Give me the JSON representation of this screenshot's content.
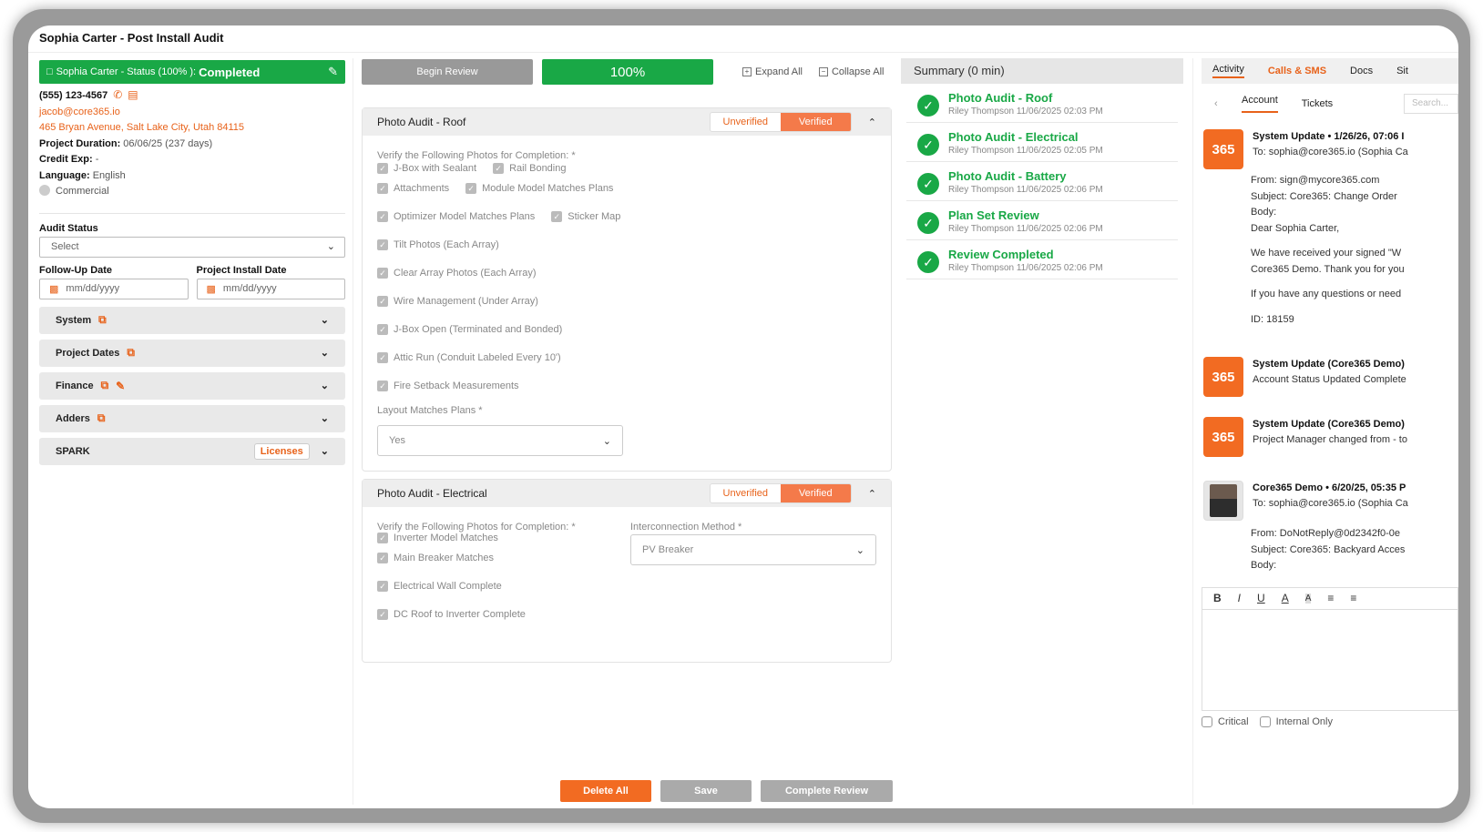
{
  "title": "Sophia Carter - Post Install Audit",
  "left": {
    "status_prefix": "Sophia Carter - Status (100% ):",
    "status_value": "Completed",
    "phone": "(555) 123-4567",
    "email": "jacob@core365.io",
    "address": "465 Bryan Avenue, Salt Lake City, Utah 84115",
    "duration_label": "Project Duration:",
    "duration_value": "06/06/25 (237 days)",
    "credit_label": "Credit Exp:",
    "credit_value": "-",
    "language_label": "Language:",
    "language_value": "English",
    "commercial": "Commercial",
    "audit_status_label": "Audit Status",
    "audit_status_value": "Select",
    "followup_label": "Follow-Up Date",
    "install_label": "Project Install Date",
    "date_placeholder": "mm/dd/yyyy",
    "sections": [
      "System",
      "Project Dates",
      "Finance",
      "Adders",
      "SPARK"
    ],
    "licenses": "Licenses"
  },
  "mid": {
    "begin_review": "Begin Review",
    "percent": "100%",
    "expand_all": "Expand All",
    "collapse_all": "Collapse All",
    "unverified": "Unverified",
    "verified": "Verified",
    "roof": {
      "title": "Photo Audit - Roof",
      "verify_label": "Verify the Following Photos for Completion: *",
      "rows": [
        [
          "J-Box with Sealant",
          "Rail Bonding"
        ],
        [
          "Attachments",
          "Module Model Matches Plans"
        ],
        [
          "Optimizer Model Matches Plans",
          "Sticker Map"
        ],
        [
          "Tilt Photos (Each Array)"
        ],
        [
          "Clear Array Photos (Each Array)"
        ],
        [
          "Wire Management (Under Array)"
        ],
        [
          "J-Box Open (Terminated and Bonded)"
        ],
        [
          "Attic Run (Conduit Labeled Every 10')"
        ],
        [
          "Fire Setback Measurements"
        ]
      ],
      "layout_label": "Layout Matches Plans *",
      "layout_value": "Yes"
    },
    "electrical": {
      "title": "Photo Audit - Electrical",
      "verify_label": "Verify the Following Photos for Completion: *",
      "items": [
        "Inverter Model Matches",
        "Main Breaker Matches",
        "Electrical Wall Complete",
        "DC Roof to Inverter Complete"
      ],
      "interconnect_label": "Interconnection Method *",
      "interconnect_value": "PV Breaker"
    },
    "delete_all": "Delete All",
    "save": "Save",
    "complete_review": "Complete Review"
  },
  "summary": {
    "title": "Summary (0 min)",
    "items": [
      {
        "title": "Photo Audit - Roof",
        "sub": "Riley Thompson 11/06/2025 02:03 PM"
      },
      {
        "title": "Photo Audit - Electrical",
        "sub": "Riley Thompson 11/06/2025 02:05 PM"
      },
      {
        "title": "Photo Audit - Battery",
        "sub": "Riley Thompson 11/06/2025 02:06 PM"
      },
      {
        "title": "Plan Set Review",
        "sub": "Riley Thompson 11/06/2025 02:06 PM"
      },
      {
        "title": "Review Completed",
        "sub": "Riley Thompson 11/06/2025 02:06 PM"
      }
    ]
  },
  "right": {
    "tabs": [
      "Activity",
      "Calls & SMS",
      "Docs",
      "Sit"
    ],
    "subtabs": [
      "Account",
      "Tickets"
    ],
    "search_placeholder": "Search...",
    "m1_title": "System Update • 1/26/26, 07:06 I",
    "m1_to": "To: sophia@core365.io (Sophia Ca",
    "m1_body": [
      "From: sign@mycore365.com",
      "Subject: Core365: Change Order",
      "Body:",
      "Dear Sophia Carter,",
      "",
      "We have received your signed \"W",
      "Core365 Demo. Thank you for you",
      "",
      "If you have any questions or need",
      "",
      "ID: 18159"
    ],
    "m2_title": "System Update (Core365 Demo)",
    "m2_sub": "Account Status Updated Complete",
    "m3_title": "System Update (Core365 Demo)",
    "m3_sub": "Project Manager changed from - to",
    "m4_title": "Core365 Demo • 6/20/25, 05:35 P",
    "m4_to": "To: sophia@core365.io (Sophia Ca",
    "m4_body": [
      "From: DoNotReply@0d2342f0-0e",
      "Subject: Core365: Backyard Acces",
      "Body:"
    ],
    "critical": "Critical",
    "internal": "Internal Only"
  }
}
